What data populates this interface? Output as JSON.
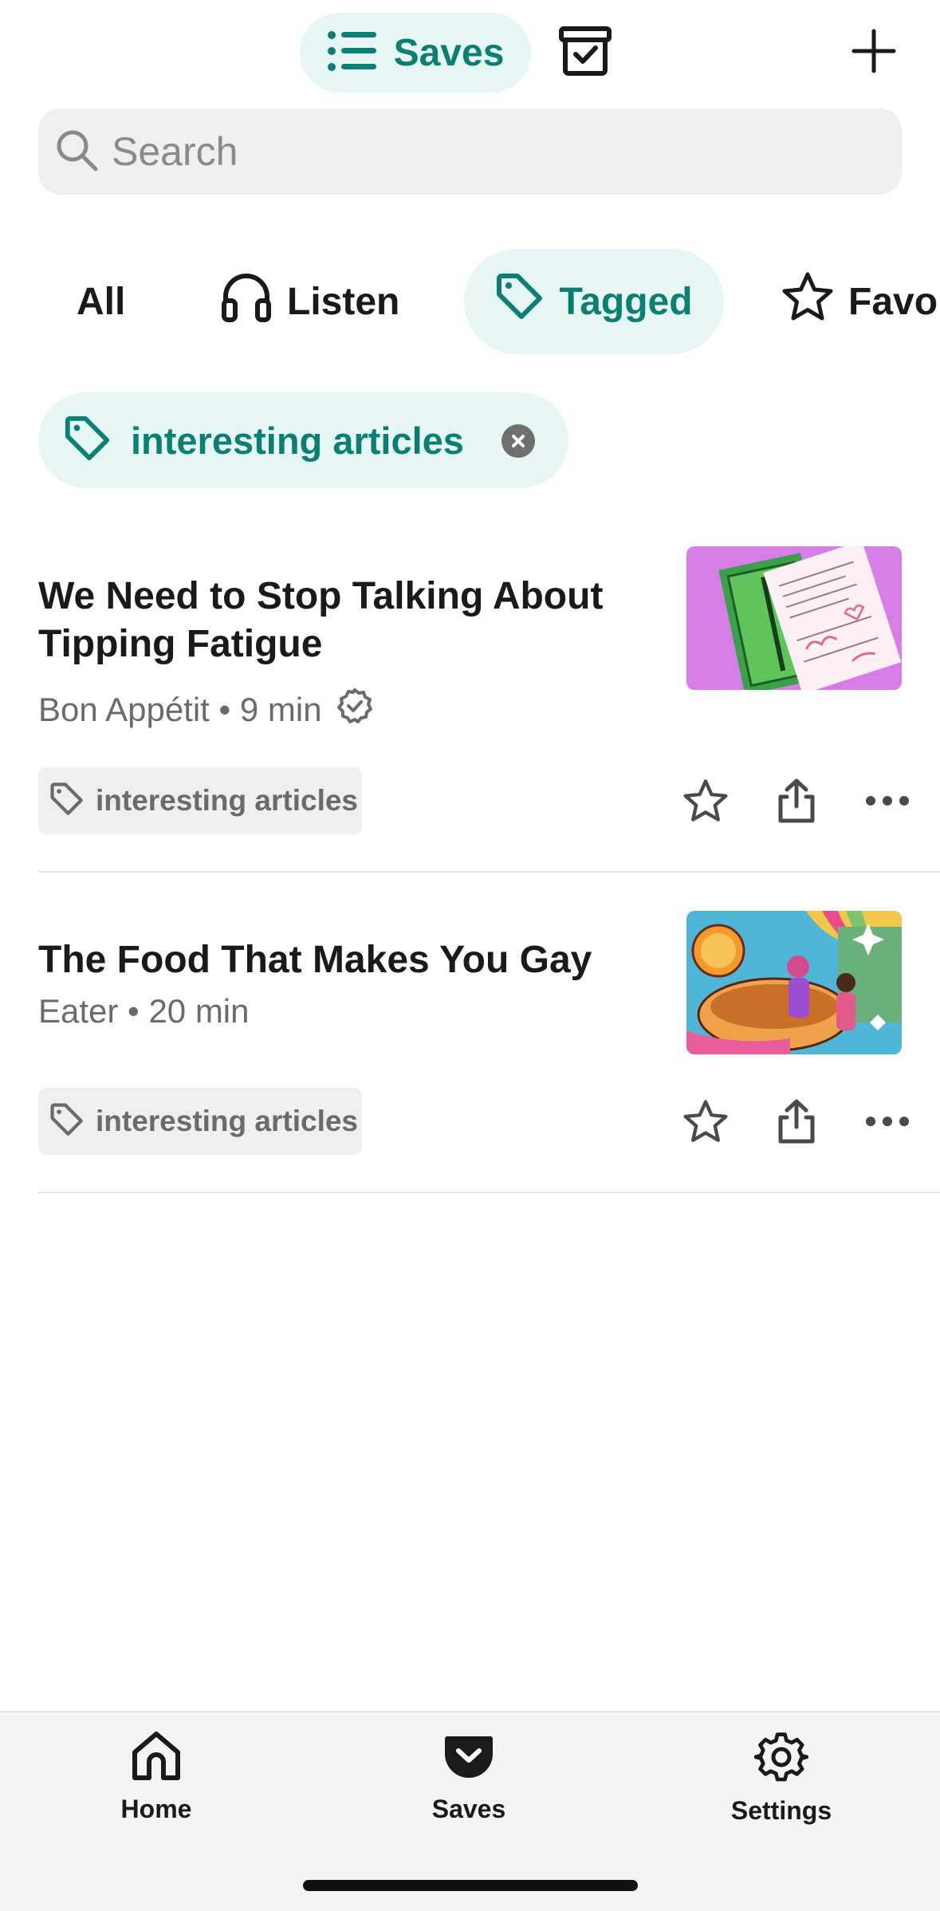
{
  "header": {
    "saves_label": "Saves",
    "icons": {
      "list": "list-icon",
      "archive": "archive-icon",
      "add": "plus-icon"
    }
  },
  "search": {
    "placeholder": "Search"
  },
  "filters": [
    {
      "label": "All"
    },
    {
      "label": "Listen",
      "icon": "headphones-icon"
    },
    {
      "label": "Tagged",
      "icon": "tag-icon",
      "active": true
    },
    {
      "label": "Favo",
      "icon": "star-icon"
    }
  ],
  "active_tag": {
    "label": "interesting articles"
  },
  "articles": [
    {
      "title": "We Need to Stop Talking About Tipping Fatigue",
      "source": "Bon Appétit",
      "read_time": "9 min",
      "verified": true,
      "tag": "interesting articles"
    },
    {
      "title": "The Food That Makes You Gay",
      "source": "Eater",
      "read_time": "20 min",
      "verified": false,
      "tag": "interesting articles"
    }
  ],
  "nav": [
    {
      "label": "Home",
      "icon": "home-icon"
    },
    {
      "label": "Saves",
      "icon": "pocket-icon"
    },
    {
      "label": "Settings",
      "icon": "gear-icon"
    }
  ],
  "colors": {
    "accent": "#0c7f73",
    "accent_bg": "#e6f6f3"
  }
}
